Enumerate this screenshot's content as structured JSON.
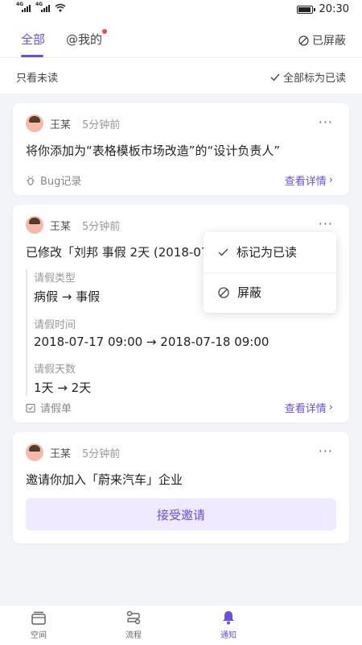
{
  "status": {
    "time": "20:30",
    "sig1": "4G",
    "sig2": "4G"
  },
  "tabs": {
    "all": "全部",
    "mine": "@我的",
    "blocked": "已屏蔽"
  },
  "filter": {
    "unread_only": "只看未读",
    "mark_all_read": "全部标为已读"
  },
  "cards": [
    {
      "user": "王某",
      "time": "5分钟前",
      "message": "将你添加为“表格模板市场改造”的“设计负责人”",
      "source": "Bug记录",
      "link": "查看详情"
    },
    {
      "user": "王某",
      "time": "5分钟前",
      "message": "已修改「刘邦 事假 2天 (2018-07",
      "details": [
        {
          "label": "请假类型",
          "value": "病假 → 事假"
        },
        {
          "label": "请假时间",
          "value": "2018-07-17 09:00 → 2018-07-18 09:00"
        },
        {
          "label": "请假天数",
          "value": "1天 → 2天"
        }
      ],
      "source": "请假单",
      "link": "查看详情"
    },
    {
      "user": "王某",
      "time": "5分钟前",
      "message": "邀请你加入「蔚来汽车」企业",
      "action": "接受邀请"
    }
  ],
  "popup": {
    "mark_read": "标记为已读",
    "block": "屏蔽"
  },
  "nav": [
    {
      "label": "空间",
      "icon": "space-icon"
    },
    {
      "label": "流程",
      "icon": "flow-icon"
    },
    {
      "label": "通知",
      "icon": "bell-icon"
    }
  ],
  "colors": {
    "accent": "#6b4fd8",
    "badge": "#ef4a4a"
  }
}
